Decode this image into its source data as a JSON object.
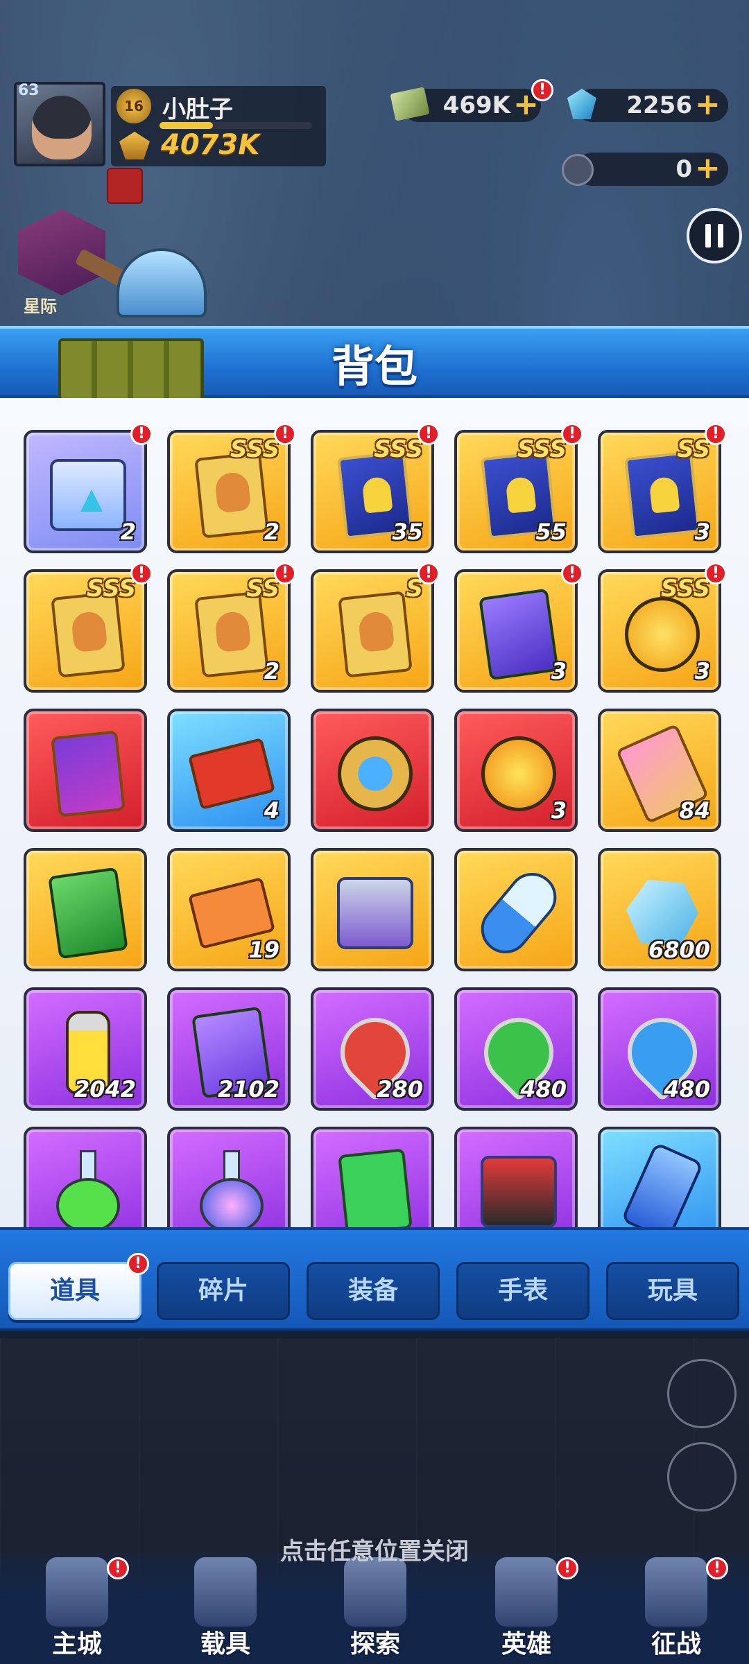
{
  "hud": {
    "player_level": "63",
    "rank_level": "16",
    "player_name": "小肚子",
    "power": "4073K",
    "cash": "469K",
    "gems": "2256",
    "coins": "0",
    "side_profile_label": "星际"
  },
  "panel": {
    "title": "背包"
  },
  "items": [
    {
      "rank": "",
      "count": "2",
      "alert": true,
      "bg": "lav",
      "art": "chest"
    },
    {
      "rank": "SSS",
      "count": "2",
      "alert": true,
      "bg": "gold",
      "art": "card"
    },
    {
      "rank": "SSS",
      "count": "35",
      "alert": true,
      "bg": "gold",
      "art": "shard"
    },
    {
      "rank": "SSS",
      "count": "55",
      "alert": true,
      "bg": "gold",
      "art": "shard"
    },
    {
      "rank": "SS",
      "count": "3",
      "alert": true,
      "bg": "gold",
      "art": "shard"
    },
    {
      "rank": "SSS",
      "count": "",
      "alert": true,
      "bg": "gold",
      "art": "card"
    },
    {
      "rank": "SS",
      "count": "2",
      "alert": true,
      "bg": "gold",
      "art": "card"
    },
    {
      "rank": "S",
      "count": "",
      "alert": true,
      "bg": "gold",
      "art": "card"
    },
    {
      "rank": "",
      "count": "3",
      "alert": true,
      "bg": "gold",
      "art": "book-purple"
    },
    {
      "rank": "SSS",
      "count": "3",
      "alert": true,
      "bg": "gold",
      "art": "emoji"
    },
    {
      "rank": "",
      "count": "",
      "alert": false,
      "bg": "red",
      "art": "w-card"
    },
    {
      "rank": "",
      "count": "4",
      "alert": false,
      "bg": "blue",
      "art": "red-ticket"
    },
    {
      "rank": "",
      "count": "",
      "alert": false,
      "bg": "red",
      "art": "medal"
    },
    {
      "rank": "",
      "count": "3",
      "alert": false,
      "bg": "red",
      "art": "planet"
    },
    {
      "rank": "",
      "count": "84",
      "alert": false,
      "bg": "gold",
      "art": "phone"
    },
    {
      "rank": "",
      "count": "",
      "alert": false,
      "bg": "gold",
      "art": "book-green"
    },
    {
      "rank": "",
      "count": "19",
      "alert": false,
      "bg": "gold",
      "art": "ticket"
    },
    {
      "rank": "",
      "count": "",
      "alert": false,
      "bg": "gold",
      "art": "machine"
    },
    {
      "rank": "",
      "count": "",
      "alert": false,
      "bg": "gold",
      "art": "capsule"
    },
    {
      "rank": "",
      "count": "6800",
      "alert": false,
      "bg": "gold",
      "art": "ore"
    },
    {
      "rank": "",
      "count": "2042",
      "alert": false,
      "bg": "purple",
      "art": "bottle"
    },
    {
      "rank": "",
      "count": "2102",
      "alert": false,
      "bg": "purple",
      "art": "tool-card"
    },
    {
      "rank": "",
      "count": "280",
      "alert": false,
      "bg": "purple",
      "art": "pin-red"
    },
    {
      "rank": "",
      "count": "480",
      "alert": false,
      "bg": "purple",
      "art": "pin-green"
    },
    {
      "rank": "",
      "count": "480",
      "alert": false,
      "bg": "purple",
      "art": "pin-blue"
    },
    {
      "rank": "",
      "count": "",
      "alert": false,
      "bg": "purple",
      "art": "flask-green"
    },
    {
      "rank": "",
      "count": "",
      "alert": false,
      "bg": "purple",
      "art": "flask-blue"
    },
    {
      "rank": "",
      "count": "",
      "alert": false,
      "bg": "purple",
      "art": "chip"
    },
    {
      "rank": "",
      "count": "",
      "alert": false,
      "bg": "purple",
      "art": "robot"
    },
    {
      "rank": "",
      "count": "",
      "alert": false,
      "bg": "blue",
      "art": "can"
    }
  ],
  "tabs": [
    {
      "label": "道具",
      "active": true,
      "alert": true
    },
    {
      "label": "碎片",
      "active": false,
      "alert": false
    },
    {
      "label": "装备",
      "active": false,
      "alert": false
    },
    {
      "label": "手表",
      "active": false,
      "alert": false
    },
    {
      "label": "玩具",
      "active": false,
      "alert": false
    }
  ],
  "close_hint": "点击任意位置关闭",
  "nav": [
    {
      "label": "主城",
      "alert": true
    },
    {
      "label": "载具",
      "alert": false
    },
    {
      "label": "探索",
      "alert": false
    },
    {
      "label": "英雄",
      "alert": true
    },
    {
      "label": "征战",
      "alert": true
    }
  ],
  "colors": {
    "panel_blue": "#1d6fcf",
    "gold_tile": "#f6a516",
    "purple_tile": "#8c2fe0",
    "red_tile": "#d31f2c",
    "alert_red": "#e21f28",
    "power_yellow": "#f7c33b"
  },
  "icons": {
    "pause": "pause-icon",
    "cash": "cash-icon",
    "gem": "gem-icon",
    "coin": "coin-icon",
    "plus": "plus-icon",
    "alert": "exclamation-icon"
  }
}
